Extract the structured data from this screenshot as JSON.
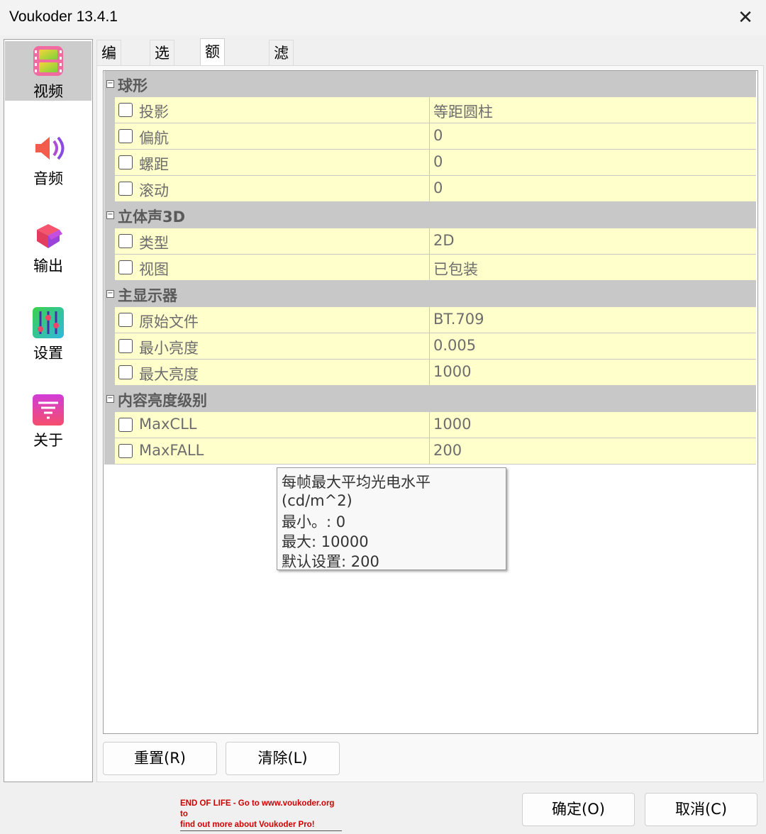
{
  "window": {
    "title": "Voukoder 13.4.1"
  },
  "sidebar": {
    "items": [
      {
        "label": "视频",
        "icon": "video-film-icon",
        "selected": true
      },
      {
        "label": "音频",
        "icon": "speaker-icon",
        "selected": false
      },
      {
        "label": "输出",
        "icon": "box-icon",
        "selected": false
      },
      {
        "label": "设置",
        "icon": "sliders-icon",
        "selected": false
      },
      {
        "label": "关于",
        "icon": "tornado-logo-icon",
        "selected": false
      }
    ]
  },
  "tabs": [
    {
      "label": "编码器",
      "active": false
    },
    {
      "label": "选项",
      "active": false
    },
    {
      "label": "额外数据",
      "active": true
    },
    {
      "label": "滤镜",
      "active": false
    }
  ],
  "grid": {
    "categories": [
      {
        "name": "球形",
        "rows": [
          {
            "label": "投影",
            "value": "等距圆柱"
          },
          {
            "label": "偏航",
            "value": "0"
          },
          {
            "label": "螺距",
            "value": "0"
          },
          {
            "label": "滚动",
            "value": "0"
          }
        ]
      },
      {
        "name": "立体声3D",
        "rows": [
          {
            "label": "类型",
            "value": "2D"
          },
          {
            "label": "视图",
            "value": "已包装"
          }
        ]
      },
      {
        "name": "主显示器",
        "rows": [
          {
            "label": "原始文件",
            "value": "BT.709"
          },
          {
            "label": "最小亮度",
            "value": "0.005"
          },
          {
            "label": "最大亮度",
            "value": "1000"
          }
        ]
      },
      {
        "name": "内容亮度级别",
        "rows": [
          {
            "label": "MaxCLL",
            "value": "1000"
          },
          {
            "label": "MaxFALL",
            "value": "200"
          }
        ]
      }
    ]
  },
  "tooltip": {
    "line1": "每帧最大平均光电水平 (cd/m^2)",
    "line2": "最小。: 0",
    "line3": "最大: 10000",
    "line4": "默认设置: 200"
  },
  "buttons": {
    "reset": "重置(R)",
    "clear": "清除(L)",
    "ok": "确定(O)",
    "cancel": "取消(C)"
  },
  "eol_notice": {
    "line1": "END OF LIFE - Go to www.voukoder.org to",
    "line2": "find out more about Voukoder Pro!"
  },
  "colors": {
    "row_bg": "#ffffcc",
    "category_bg": "#c8c8c8",
    "selected_nav": "#cccccc",
    "eol_text": "#d00000"
  }
}
